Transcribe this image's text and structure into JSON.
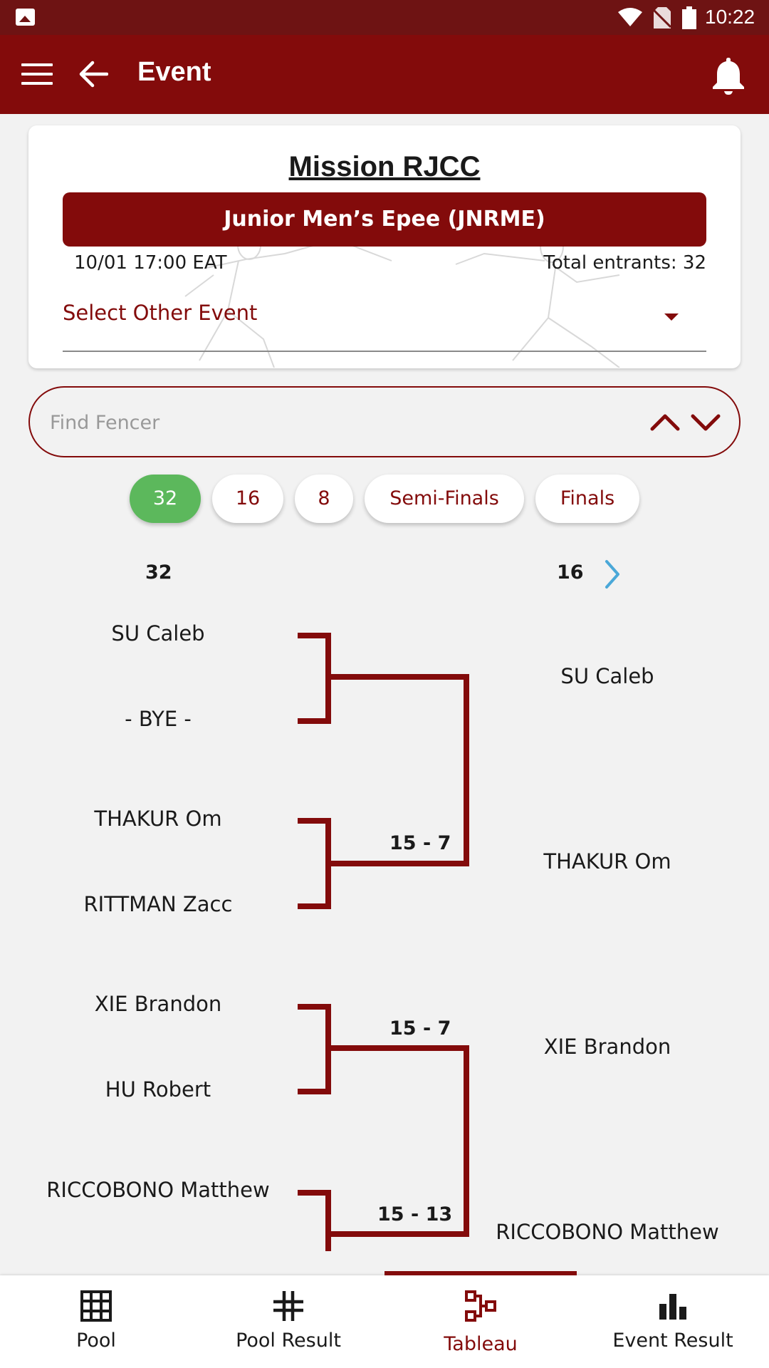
{
  "status_bar": {
    "time": "10:22"
  },
  "app_bar": {
    "title": "Event"
  },
  "event": {
    "club": "Mission RJCC",
    "name": "Junior Men’s Epee (JNRME)",
    "datetime": "10/01 17:00 EAT",
    "entrants": "Total entrants: 32",
    "select_label": "Select Other Event"
  },
  "search": {
    "placeholder": "Find Fencer"
  },
  "round_tabs": [
    "32",
    "16",
    "8",
    "Semi-Finals",
    "Finals"
  ],
  "active_round_tab": "32",
  "columns": {
    "left": "32",
    "right": "16"
  },
  "bouts": [
    {
      "a": "SU Caleb",
      "b": "- BYE -",
      "score": "",
      "winner": "SU Caleb"
    },
    {
      "a": "THAKUR Om",
      "b": "RITTMAN Zacc",
      "score": "15 - 7",
      "winner": "THAKUR Om"
    },
    {
      "a": "XIE Brandon",
      "b": "HU Robert",
      "score": "15 - 7",
      "winner": "XIE Brandon"
    },
    {
      "a": "RICCOBONO Matthew",
      "b": "",
      "score": "15 - 13",
      "winner": "RICCOBONO Matthew"
    }
  ],
  "bottom_nav": [
    "Pool",
    "Pool Result",
    "Tableau",
    "Event Result"
  ],
  "active_nav": "Tableau",
  "colors": {
    "primary": "#830b0b",
    "status_bar": "#6e1313",
    "active_chip": "#5cb85c",
    "next_arrow": "#4aa8d8"
  }
}
